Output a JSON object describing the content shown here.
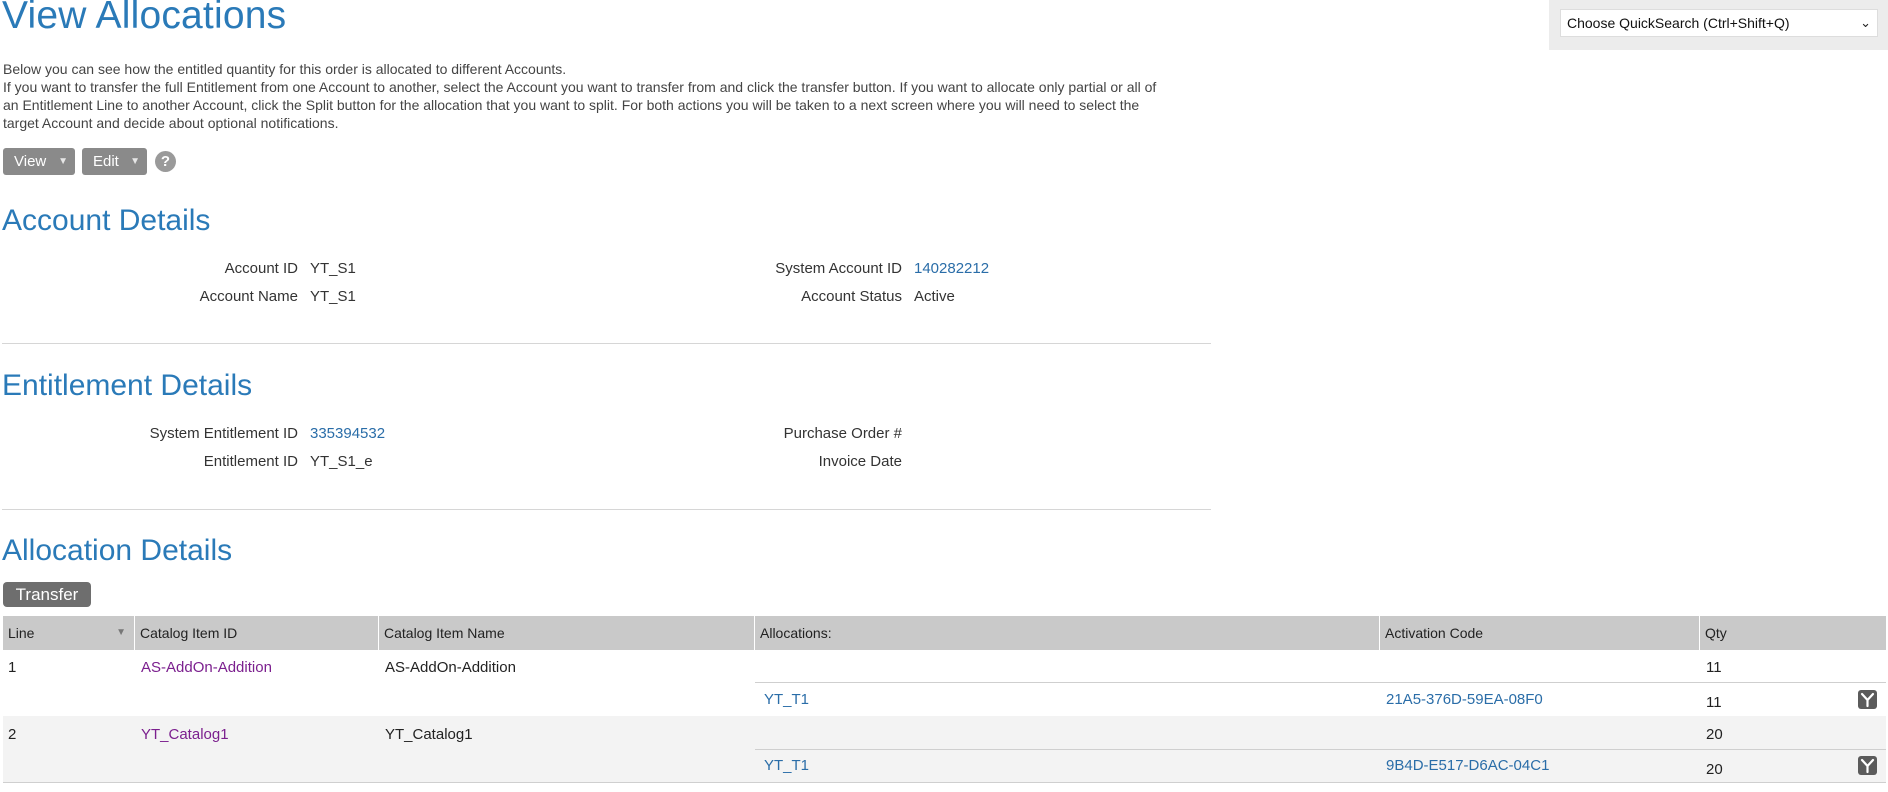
{
  "page": {
    "title": "View Allocations",
    "intro_line1": "Below you can see how the entitled quantity for this order is allocated to different Accounts.",
    "intro_line2": "If you want to transfer the full Entitlement from one Account to another, select the Account you want to transfer from and click the transfer button. If you want to allocate only partial or all of an Entitlement Line to another Account, click the Split button for the allocation that you want to split. For both actions you will be taken to a next screen where you will need to select the target Account and decide about optional notifications."
  },
  "quicksearch": {
    "selected": "Choose QuickSearch (Ctrl+Shift+Q)",
    "chevron": "⌄"
  },
  "toolbar": {
    "view_label": "View",
    "edit_label": "Edit",
    "caret": "▼",
    "help_icon": "?"
  },
  "account": {
    "section_title": "Account Details",
    "account_id_label": "Account ID",
    "account_id": "YT_S1",
    "account_name_label": "Account Name",
    "account_name": "YT_S1",
    "system_account_id_label": "System Account ID",
    "system_account_id": "140282212",
    "account_status_label": "Account Status",
    "account_status": "Active"
  },
  "entitlement": {
    "section_title": "Entitlement Details",
    "system_entitlement_id_label": "System Entitlement ID",
    "system_entitlement_id": "335394532",
    "entitlement_id_label": "Entitlement ID",
    "entitlement_id": "YT_S1_e",
    "purchase_order_label": "Purchase Order #",
    "purchase_order": "",
    "invoice_date_label": "Invoice Date",
    "invoice_date": ""
  },
  "allocation": {
    "section_title": "Allocation Details",
    "transfer_label": "Transfer",
    "columns": {
      "line": "Line",
      "catalog_item_id": "Catalog Item ID",
      "catalog_item_name": "Catalog Item Name",
      "allocations": "Allocations:",
      "activation_code": "Activation Code",
      "qty": "Qty"
    },
    "sort_caret": "▼",
    "rows": [
      {
        "line": "1",
        "catalog_item_id": "AS-AddOn-Addition",
        "catalog_item_name": "AS-AddOn-Addition",
        "qty": "11",
        "sub": {
          "allocation": "YT_T1",
          "activation_code": "21A5-376D-59EA-08F0",
          "qty": "11",
          "icon": "split-icon"
        }
      },
      {
        "line": "2",
        "catalog_item_id": "YT_Catalog1",
        "catalog_item_name": "YT_Catalog1",
        "qty": "20",
        "sub": {
          "allocation": "YT_T1",
          "activation_code": "9B4D-E517-D6AC-04C1",
          "qty": "20",
          "icon": "split-icon"
        }
      }
    ]
  },
  "colors": {
    "heading": "#2a7ab8",
    "link": "#2a6da8",
    "catalog_link": "#7b1f8e"
  }
}
